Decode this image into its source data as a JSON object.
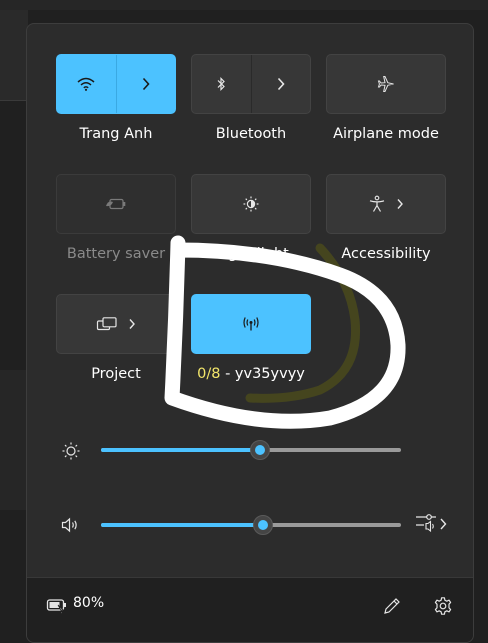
{
  "tiles": {
    "wifi": {
      "label": "Trang Anh",
      "icon": "wifi-icon",
      "state": "on"
    },
    "bluetooth": {
      "label": "Bluetooth",
      "icon": "bluetooth-icon",
      "state": "off"
    },
    "airplane": {
      "label": "Airplane mode",
      "icon": "airplane-icon",
      "state": "off"
    },
    "battery_saver": {
      "label": "Battery saver",
      "icon": "battery-saver-icon",
      "state": "disabled"
    },
    "night_light": {
      "label": "Night light",
      "icon": "night-light-icon",
      "state": "off"
    },
    "accessibility": {
      "label": "Accessibility",
      "icon": "accessibility-icon",
      "state": "off"
    },
    "project": {
      "label": "Project",
      "icon": "project-icon",
      "state": "off"
    },
    "hotspot": {
      "label_count": "0/8",
      "label_name": " - yv35yvyy",
      "icon": "hotspot-icon",
      "state": "on"
    }
  },
  "sliders": {
    "brightness": {
      "icon": "brightness-icon",
      "value_percent": 53
    },
    "volume": {
      "icon": "speaker-icon",
      "value_percent": 54,
      "extra_icon": "audio-output-icon"
    }
  },
  "footer": {
    "battery_icon": "battery-charging-icon",
    "battery_percent": "80%",
    "edit_icon": "pencil-icon",
    "settings_icon": "gear-icon"
  },
  "colors": {
    "accent": "#4cc2ff",
    "panel": "#2c2c2c",
    "tile": "#373737",
    "footer": "#202020",
    "highlight_text": "#f3e66b",
    "scribble_white": "#ffffff",
    "scribble_olive": "#4a4a1c"
  }
}
